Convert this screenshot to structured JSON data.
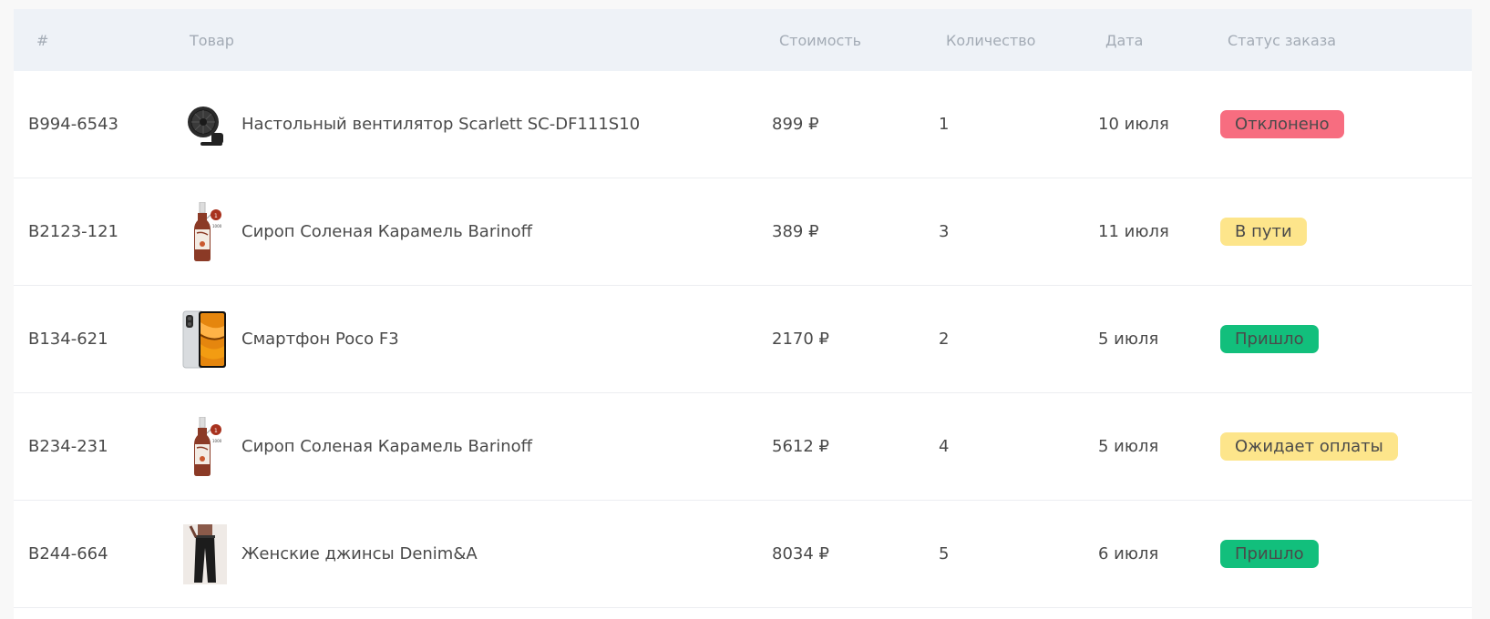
{
  "table": {
    "headers": {
      "id": "#",
      "product": "Товар",
      "cost": "Стоимость",
      "quantity": "Количество",
      "date": "Дата",
      "status": "Статус заказа"
    },
    "rows": [
      {
        "id": "B994-6543",
        "product": "Настольный вентилятор Scarlett SC-DF111S10",
        "image": "fan-icon",
        "cost": "899 ₽",
        "quantity": "1",
        "date": "10 июля",
        "status": "Отклонено",
        "status_color": "#f76d80"
      },
      {
        "id": "B2123-121",
        "product": "Сироп Соленая Карамель Barinoff",
        "image": "syrup-bottle-icon",
        "cost": "389 ₽",
        "quantity": "3",
        "date": "11 июля",
        "status": "В пути",
        "status_color": "#fde58b"
      },
      {
        "id": "B134-621",
        "product": "Смартфон Poco F3",
        "image": "smartphone-icon",
        "cost": "2170 ₽",
        "quantity": "2",
        "date": "5 июля",
        "status": "Пришло",
        "status_color": "#12bf7c"
      },
      {
        "id": "B234-231",
        "product": "Сироп Соленая Карамель Barinoff",
        "image": "syrup-bottle-icon",
        "cost": "5612 ₽",
        "quantity": "4",
        "date": "5 июля",
        "status": "Ожидает оплаты",
        "status_color": "#fde58b"
      },
      {
        "id": "B244-664",
        "product": "Женские джинсы Denim&A",
        "image": "jeans-icon",
        "cost": "8034 ₽",
        "quantity": "5",
        "date": "6 июля",
        "status": "Пришло",
        "status_color": "#12bf7c"
      }
    ]
  }
}
